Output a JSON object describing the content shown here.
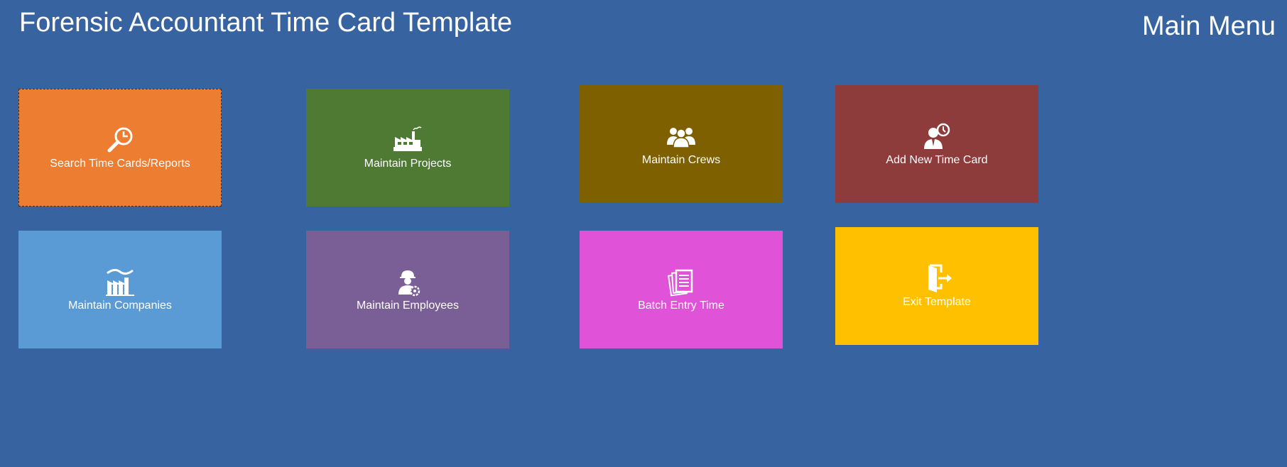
{
  "header": {
    "app_title": "Forensic Accountant Time Card Template",
    "menu_title": "Main Menu"
  },
  "tiles": [
    {
      "label": "Search Time Cards/Reports",
      "icon": "search-report-icon",
      "color": "#ed7d31"
    },
    {
      "label": "Maintain Projects",
      "icon": "factory-icon",
      "color": "#4e7a33"
    },
    {
      "label": "Maintain Crews",
      "icon": "crew-icon",
      "color": "#7f6000"
    },
    {
      "label": "Add New Time Card",
      "icon": "employee-clock-icon",
      "color": "#8e3b3b"
    },
    {
      "label": "Maintain Companies",
      "icon": "company-building-icon",
      "color": "#5b9bd5"
    },
    {
      "label": "Maintain Employees",
      "icon": "worker-gear-icon",
      "color": "#7a5f96"
    },
    {
      "label": "Batch Entry Time",
      "icon": "documents-icon",
      "color": "#e052d8"
    },
    {
      "label": "Exit Template",
      "icon": "exit-door-icon",
      "color": "#ffc000"
    }
  ],
  "colors": {
    "background": "#3764a0"
  }
}
